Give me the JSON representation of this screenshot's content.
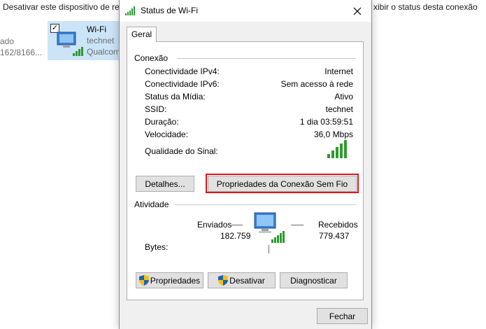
{
  "background": {
    "toolbar_left": "Desativar este dispositivo de rede",
    "toolbar_right": "xibir o status desta conexão",
    "left_fragment_1": "ado",
    "left_fragment_2": "162/8166...",
    "adapter": {
      "name": "Wi-Fi",
      "network": "technet",
      "device": "Qualcomm"
    }
  },
  "dialog": {
    "title": "Status de Wi-Fi",
    "tab": "Geral",
    "connection": {
      "group_title": "Conexão",
      "rows": [
        {
          "label": "Conectividade IPv4:",
          "value": "Internet"
        },
        {
          "label": "Conectividade IPv6:",
          "value": "Sem acesso à rede"
        },
        {
          "label": "Status da Mídia:",
          "value": "Ativo"
        },
        {
          "label": "SSID:",
          "value": "technet"
        },
        {
          "label": "Duração:",
          "value": "1 dia 03:59:51"
        },
        {
          "label": "Velocidade:",
          "value": "36,0 Mbps"
        }
      ],
      "signal_label": "Qualidade do Sinal:",
      "signal_bars": 5,
      "details_button": "Detalhes...",
      "wireless_props_button": "Propriedades da Conexão Sem Fio"
    },
    "activity": {
      "group_title": "Atividade",
      "sent_label": "Enviados",
      "received_label": "Recebidos",
      "bytes_label": "Bytes:",
      "sent_value": "182.759",
      "received_value": "779.437"
    },
    "buttons": {
      "properties": "Propriedades",
      "disable": "Desativar",
      "diagnose": "Diagnosticar",
      "close": "Fechar"
    },
    "highlight_color": "#e0141b",
    "signal_color": "#2f9a2f"
  }
}
